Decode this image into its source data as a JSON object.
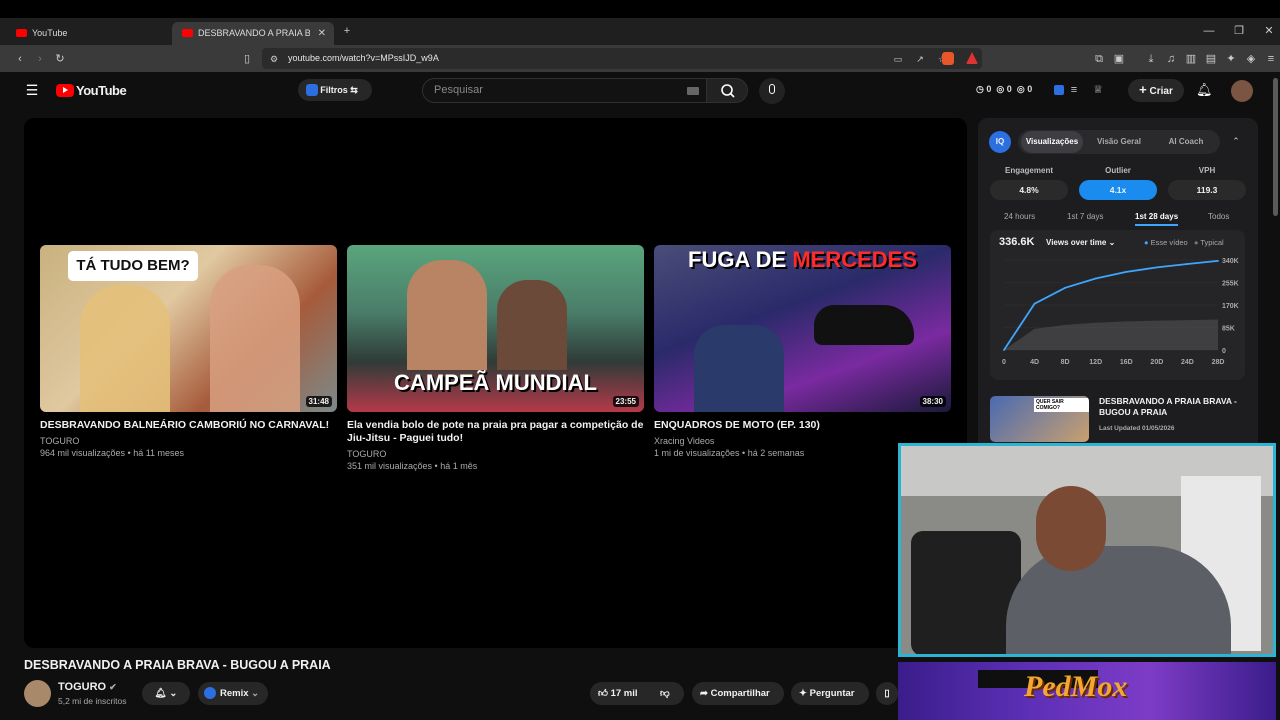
{
  "browser": {
    "tabs": [
      {
        "title": "YouTube"
      },
      {
        "title": "DESBRAVANDO A PRAIA BRAVA"
      }
    ],
    "url": "youtube.com/watch?v=MPssIJD_w9A"
  },
  "header": {
    "logo_text": "YouTube",
    "filters_label": "Filtros",
    "search_placeholder": "Pesquisar",
    "counters": [
      "0",
      "0",
      "0"
    ],
    "create_label": "Criar"
  },
  "related_videos": [
    {
      "title": "DESBRAVANDO BALNEÁRIO CAMBORIÚ NO CARNAVAL!",
      "channel": "TOGURO",
      "meta": "964 mil visualizações • há 11 meses",
      "duration": "31:48",
      "thumb_text": "TÁ TUDO BEM?"
    },
    {
      "title": "Ela vendia bolo de pote na praia pra pagar a competição de Jiu-Jitsu - Paguei tudo!",
      "channel": "TOGURO",
      "meta": "351 mil visualizações • há 1 mês",
      "duration": "23:55",
      "thumb_text": "CAMPEÃ MUNDIAL"
    },
    {
      "title": "ENQUADROS DE MOTO (EP. 130)",
      "channel": "Xracing Videos",
      "meta": "1 mi de visualizações • há 2 semanas",
      "duration": "38:30",
      "thumb_text_a": "FUGA DE",
      "thumb_text_b": "MERCEDES"
    }
  ],
  "video": {
    "title": "DESBRAVANDO A PRAIA BRAVA - BUGOU A PRAIA",
    "channel": "TOGURO",
    "subscribers": "5,2 mi de inscritos",
    "remix_label": "Remix",
    "likes": "17 mil",
    "share_label": "Compartilhar",
    "ask_label": "Perguntar"
  },
  "vidiq": {
    "tabs": [
      "Visualizações",
      "Visão Geral",
      "AI Coach"
    ],
    "active_tab": "Visualizações",
    "stats": [
      {
        "label": "Engagement",
        "value": "4.8%"
      },
      {
        "label": "Outlier",
        "value": "4.1x"
      },
      {
        "label": "VPH",
        "value": "119.3"
      }
    ],
    "ranges": [
      "24 hours",
      "1st 7 days",
      "1st 28 days",
      "Todos"
    ],
    "active_range": "1st 28 days",
    "total_views": "336.6K",
    "metric_select": "Views over time",
    "legend_this": "Esse vídeo",
    "legend_typical": "Typical",
    "upnext_title": "DESBRAVANDO A PRAIA BRAVA - BUGOU A PRAIA",
    "upnext_meta": "Last Updated 01/05/2026",
    "upnext_thumb_text": "QUER SAIR COMIGO?"
  },
  "chart_data": {
    "type": "area",
    "x": [
      "0",
      "4D",
      "8D",
      "12D",
      "16D",
      "20D",
      "24D",
      "28D"
    ],
    "series": [
      {
        "name": "Esse vídeo",
        "values": [
          0,
          175000,
          235000,
          270000,
          295000,
          312000,
          325000,
          336600
        ]
      },
      {
        "values": [
          0,
          80000,
          95000,
          103000,
          108000,
          111000,
          113000,
          115000
        ]
      }
    ],
    "ylim": [
      0,
      340000
    ],
    "yticks": [
      "0",
      "85K",
      "170K",
      "255K",
      "340K"
    ],
    "grid": true,
    "legend_position": "top-right",
    "colors": {
      "this": "#3ea6ff",
      "typical": "#555555"
    }
  },
  "overlay": {
    "banner_text": "PedMox"
  },
  "colors": {
    "accent": "#3ea6ff",
    "brand": "#ff0000",
    "cam_border": "#2ab5d4"
  }
}
